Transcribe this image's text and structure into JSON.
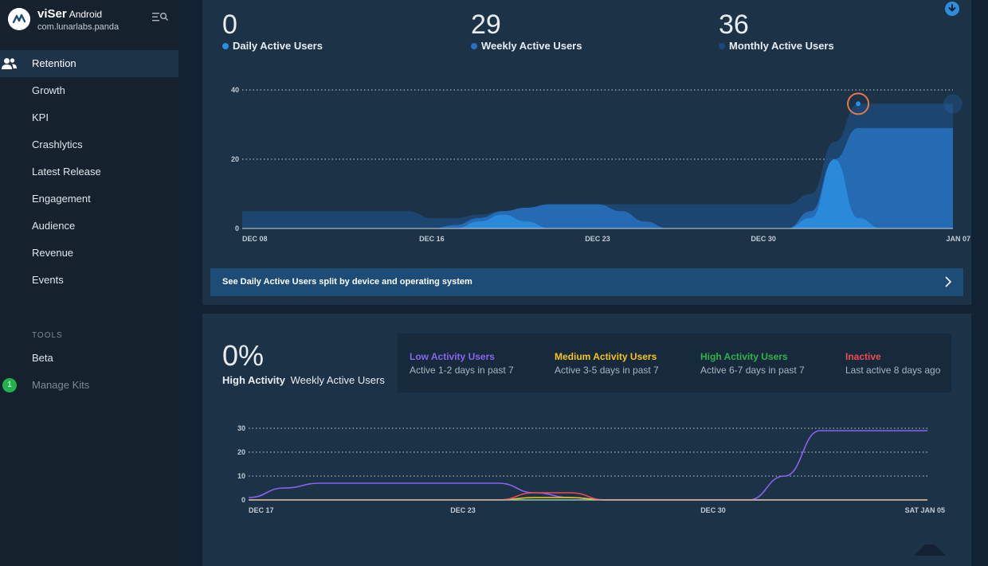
{
  "app": {
    "name": "viSer",
    "platform": "Android",
    "package": "com.lunarlabs.panda"
  },
  "nav": {
    "items": [
      {
        "label": "Retention",
        "active": true
      },
      {
        "label": "Growth"
      },
      {
        "label": "KPI"
      },
      {
        "label": "Crashlytics"
      },
      {
        "label": "Latest Release"
      },
      {
        "label": "Engagement"
      },
      {
        "label": "Audience"
      },
      {
        "label": "Revenue"
      },
      {
        "label": "Events"
      }
    ],
    "tools_label": "TOOLS",
    "beta_label": "Beta",
    "kits_label": "Manage Kits",
    "kits_badge": "1"
  },
  "active_users": {
    "metrics": [
      {
        "value": "0",
        "label": "Daily Active Users",
        "color": "#2d8ee0"
      },
      {
        "value": "29",
        "label": "Weekly Active Users",
        "color": "#2672c0"
      },
      {
        "value": "36",
        "label": "Monthly Active Users",
        "color": "#1c4a78"
      }
    ],
    "split_link": "See Daily Active Users split by device and operating system"
  },
  "activity": {
    "percent": "0%",
    "caption_strong": "High Activity",
    "caption": "Weekly Active Users",
    "legend": [
      {
        "title": "Low Activity Users",
        "desc": "Active 1-2 days in past 7",
        "color": "#8a63f0"
      },
      {
        "title": "Medium Activity Users",
        "desc": "Active 3-5 days in past 7",
        "color": "#f6c51a"
      },
      {
        "title": "High Activity Users",
        "desc": "Active 6-7 days in past 7",
        "color": "#2fb24d"
      },
      {
        "title": "Inactive",
        "desc": "Last active 8 days ago",
        "color": "#f04b55"
      }
    ]
  },
  "chart_data": [
    {
      "type": "area",
      "ylim": [
        0,
        40
      ],
      "yticks": [
        0,
        20,
        40
      ],
      "xlim": [
        "2018-12-08",
        "2019-01-07"
      ],
      "xticks": [
        "DEC 08",
        "DEC 16",
        "DEC 23",
        "DEC 30",
        "JAN 07"
      ],
      "xtick_dates": [
        "2018-12-08",
        "2018-12-16",
        "2018-12-23",
        "2018-12-30",
        "2019-01-07"
      ],
      "series": [
        {
          "name": "Monthly Active Users",
          "color": "#1c4a78",
          "x": [
            "2018-12-08",
            "2018-12-15",
            "2018-12-16",
            "2018-12-17",
            "2018-12-18",
            "2018-12-19",
            "2018-12-20",
            "2018-12-21",
            "2018-12-22",
            "2018-12-23",
            "2018-12-31",
            "2019-01-01",
            "2019-01-02",
            "2019-01-03",
            "2019-01-07"
          ],
          "y": [
            5,
            5,
            3,
            3,
            4,
            5,
            6,
            7,
            7,
            7,
            7,
            10,
            25,
            36,
            36
          ]
        },
        {
          "name": "Weekly Active Users",
          "color": "#2672c0",
          "x": [
            "2018-12-08",
            "2018-12-16",
            "2018-12-17",
            "2018-12-18",
            "2018-12-19",
            "2018-12-20",
            "2018-12-21",
            "2018-12-23",
            "2018-12-24",
            "2018-12-25",
            "2018-12-26",
            "2018-12-31",
            "2019-01-01",
            "2019-01-02",
            "2019-01-03",
            "2019-01-07"
          ],
          "y": [
            0,
            0,
            1,
            3,
            5,
            6,
            7,
            7,
            5,
            2,
            0,
            0,
            5,
            20,
            29,
            29
          ]
        },
        {
          "name": "Daily Active Users",
          "color": "#2d8ee0",
          "x": [
            "2018-12-08",
            "2018-12-17",
            "2018-12-18",
            "2018-12-19",
            "2018-12-20",
            "2018-12-21",
            "2018-12-31",
            "2019-01-01",
            "2019-01-02",
            "2019-01-03",
            "2019-01-04",
            "2019-01-07"
          ],
          "y": [
            0,
            0,
            2,
            4,
            2,
            0,
            0,
            3,
            20,
            3,
            0,
            0
          ]
        }
      ]
    },
    {
      "type": "line",
      "ylim": [
        0,
        30
      ],
      "yticks": [
        0,
        10,
        20,
        30
      ],
      "xlim": [
        "2018-12-17",
        "2019-01-05"
      ],
      "xticks": [
        "DEC 17",
        "DEC 23",
        "DEC 30",
        "SAT JAN 05"
      ],
      "xtick_dates": [
        "2018-12-17",
        "2018-12-23",
        "2018-12-30",
        "2019-01-05"
      ],
      "series": [
        {
          "name": "Low Activity Users",
          "color": "#8a63f0",
          "x": [
            "2018-12-17",
            "2018-12-18",
            "2018-12-19",
            "2018-12-20",
            "2018-12-24",
            "2018-12-25",
            "2018-12-26",
            "2018-12-27",
            "2018-12-31",
            "2019-01-01",
            "2019-01-02",
            "2019-01-05"
          ],
          "y": [
            1,
            5,
            7,
            7,
            7,
            3,
            1,
            0,
            0,
            10,
            29,
            29
          ]
        },
        {
          "name": "Medium Activity Users",
          "color": "#f6c51a",
          "x": [
            "2018-12-17",
            "2018-12-24",
            "2018-12-25",
            "2018-12-26",
            "2018-12-27",
            "2019-01-05"
          ],
          "y": [
            0,
            0,
            1,
            1,
            0,
            0
          ]
        },
        {
          "name": "High Activity Users",
          "color": "#2fb24d",
          "x": [
            "2018-12-17",
            "2019-01-05"
          ],
          "y": [
            0,
            0
          ]
        },
        {
          "name": "Inactive",
          "color": "#f04b55",
          "x": [
            "2018-12-17",
            "2018-12-24",
            "2018-12-25",
            "2018-12-26",
            "2018-12-27",
            "2019-01-05"
          ],
          "y": [
            0,
            0,
            3,
            3,
            0,
            0
          ]
        }
      ]
    }
  ]
}
